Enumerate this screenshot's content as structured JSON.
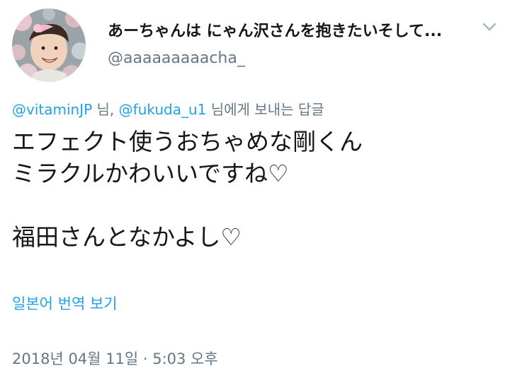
{
  "header": {
    "display_name": "あーちゃんは にゃん沢さんを抱きたいそして...",
    "username": "@aaaaaaaaacha_",
    "avatar_icon": "profile-photo",
    "menu_icon": "chevron-down-icon"
  },
  "reply_context": {
    "mention_1": "@vitaminJP",
    "suffix_1": " 님, ",
    "mention_2": "@fukuda_u1",
    "suffix_2": " 님에게 보내는 답글"
  },
  "tweet": {
    "lines": [
      "エフェクト使うおちゃめな剛くん",
      "ミラクルかわいいですね♡",
      "",
      "福田さんとなかよし♡"
    ]
  },
  "translate_label": "일본어 번역 보기",
  "timestamp": "2018년 04월 11일 · 5:03 오후",
  "colors": {
    "link": "#1da1f2",
    "secondary_text": "#657786",
    "primary_text": "#14171a"
  }
}
